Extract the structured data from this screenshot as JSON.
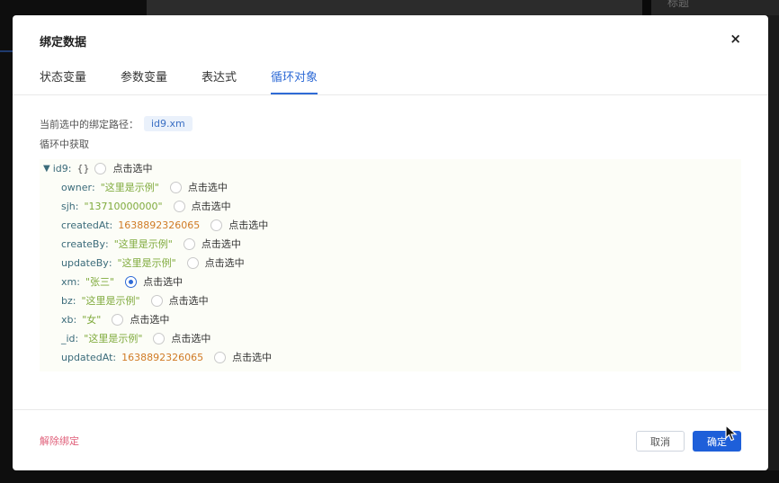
{
  "background": {
    "right_text": "标题"
  },
  "modal": {
    "title": "绑定数据",
    "close_glyph": "×"
  },
  "tabs": [
    {
      "label": "状态变量",
      "active": false
    },
    {
      "label": "参数变量",
      "active": false
    },
    {
      "label": "表达式",
      "active": false
    },
    {
      "label": "循环对象",
      "active": true
    }
  ],
  "binding": {
    "current_path_label": "当前选中的绑定路径：",
    "current_path_value": "id9.xm",
    "loop_label": "循环中获取"
  },
  "tree": {
    "root": {
      "key": "id9",
      "brace": "{}",
      "pick_label": "点击选中",
      "caret": "▼"
    },
    "fields": [
      {
        "key": "owner",
        "value": "\"这里是示例\"",
        "type": "string",
        "checked": false,
        "pick_label": "点击选中"
      },
      {
        "key": "sjh",
        "value": "\"13710000000\"",
        "type": "string",
        "checked": false,
        "pick_label": "点击选中"
      },
      {
        "key": "createdAt",
        "value": "1638892326065",
        "type": "number",
        "checked": false,
        "pick_label": "点击选中"
      },
      {
        "key": "createBy",
        "value": "\"这里是示例\"",
        "type": "string",
        "checked": false,
        "pick_label": "点击选中"
      },
      {
        "key": "updateBy",
        "value": "\"这里是示例\"",
        "type": "string",
        "checked": false,
        "pick_label": "点击选中"
      },
      {
        "key": "xm",
        "value": "\"张三\"",
        "type": "string",
        "checked": true,
        "pick_label": "点击选中"
      },
      {
        "key": "bz",
        "value": "\"这里是示例\"",
        "type": "string",
        "checked": false,
        "pick_label": "点击选中"
      },
      {
        "key": "xb",
        "value": "\"女\"",
        "type": "string",
        "checked": false,
        "pick_label": "点击选中"
      },
      {
        "key": "_id",
        "value": "\"这里是示例\"",
        "type": "string",
        "checked": false,
        "pick_label": "点击选中"
      },
      {
        "key": "updatedAt",
        "value": "1638892326065",
        "type": "number",
        "checked": false,
        "pick_label": "点击选中"
      }
    ]
  },
  "footer": {
    "unbind_label": "解除绑定",
    "cancel_label": "取消",
    "ok_label": "确定"
  },
  "colors": {
    "accent": "#2f6bd6",
    "primary_button": "#1e5fd9",
    "danger_link": "#e0607a",
    "string_value": "#7faa3c",
    "number_value": "#d07a25",
    "key": "#3b6b7a"
  }
}
